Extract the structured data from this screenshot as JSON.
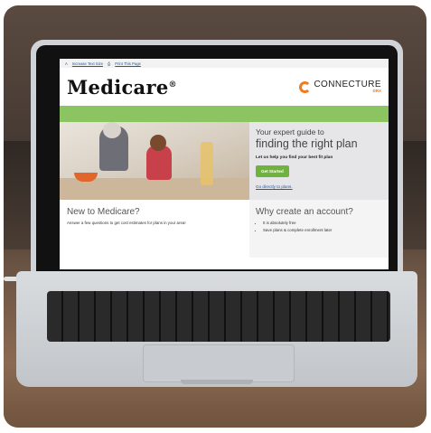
{
  "screen": {
    "topbar": {
      "text_size_icon": "A",
      "increase_text": "Increase Text Size",
      "print_icon": "print-icon",
      "print_text": "Print This Page"
    },
    "header": {
      "brand": "Medicare",
      "brand_mark": "®",
      "partner_name": "CONNECTURE",
      "partner_sub": "DRX"
    },
    "hero": {
      "line1": "Your expert guide to",
      "line2": "finding the right plan",
      "subtitle": "Let us help you find your best fit plan",
      "button": "Get Started",
      "link": "Go directly to plans."
    },
    "new_section": {
      "heading": "New to Medicare?",
      "text": "Answer a few questions to get cost estimates for plans in your area!"
    },
    "account_section": {
      "heading": "Why create an account?",
      "items": [
        "It is absolutely free",
        "Save plans & complete enrollment later"
      ]
    }
  },
  "colors": {
    "green_bar": "#8cc462",
    "button_green": "#6fb23e",
    "partner_orange": "#f07c1e",
    "link_blue": "#1f5aa6"
  }
}
